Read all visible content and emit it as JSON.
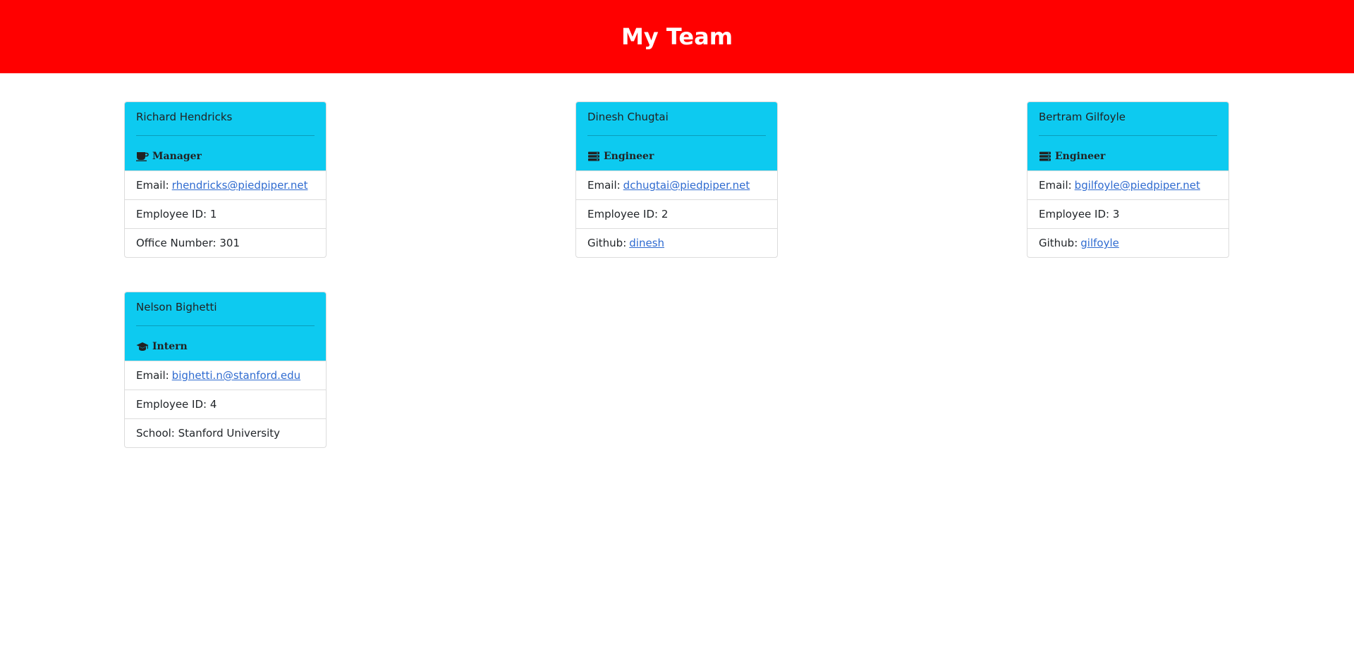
{
  "header": {
    "title": "My Team",
    "background": "#ff0000"
  },
  "theme": {
    "card_header_bg": "#0dcaf0",
    "link_color": "#2f6bd0"
  },
  "cards": [
    {
      "name": "Richard Hendricks",
      "role": "Manager",
      "role_icon": "coffee-icon",
      "email_label": "Email:",
      "email": "rhendricks@piedpiper.net",
      "id_text": "Employee ID: 1",
      "extra_label": "Office Number: 301",
      "extra_link": ""
    },
    {
      "name": "Dinesh Chugtai",
      "role": "Engineer",
      "role_icon": "server-icon",
      "email_label": "Email:",
      "email": "dchugtai@piedpiper.net",
      "id_text": "Employee ID: 2",
      "extra_label": "Github:",
      "extra_link": "dinesh"
    },
    {
      "name": "Bertram Gilfoyle",
      "role": "Engineer",
      "role_icon": "server-icon",
      "email_label": "Email:",
      "email": "bgilfoyle@piedpiper.net",
      "id_text": "Employee ID: 3",
      "extra_label": "Github:",
      "extra_link": "gilfoyle"
    },
    {
      "name": "Nelson Bighetti",
      "role": "Intern",
      "role_icon": "graduation-cap-icon",
      "email_label": "Email:",
      "email": "bighetti.n@stanford.edu",
      "id_text": "Employee ID: 4",
      "extra_label": "School: Stanford University",
      "extra_link": ""
    }
  ]
}
